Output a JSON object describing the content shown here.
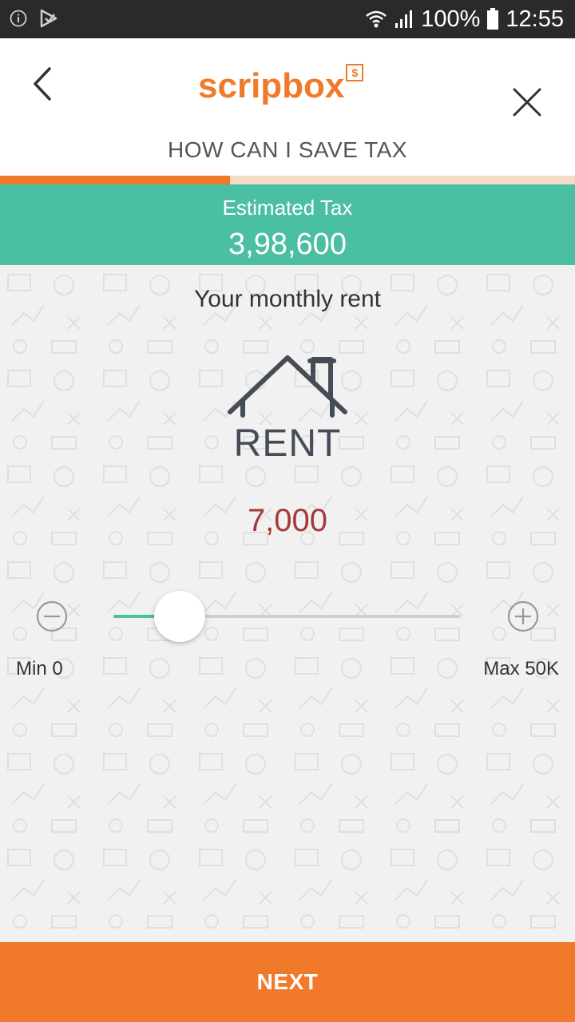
{
  "status_bar": {
    "left_icons": [
      "info-icon",
      "play-store-icon"
    ],
    "battery_pct": "100%",
    "time": "12:55"
  },
  "header": {
    "logo_text": "scripbox",
    "logo_badge": "$",
    "page_heading": "HOW CAN I SAVE TAX",
    "progress_fraction": 0.4
  },
  "tax": {
    "label": "Estimated Tax",
    "value": "3,98,600"
  },
  "rent": {
    "question": "Your monthly rent",
    "icon_label": "RENT",
    "amount": "7,000",
    "slider_value": 7000,
    "slider_min": 0,
    "slider_max": 50000,
    "min_label": "Min 0",
    "max_label": "Max 50K"
  },
  "footer": {
    "next_label": "NEXT"
  },
  "colors": {
    "accent": "#f07a2a",
    "teal": "#4bbfa2",
    "amount_text": "#a33a3a"
  }
}
